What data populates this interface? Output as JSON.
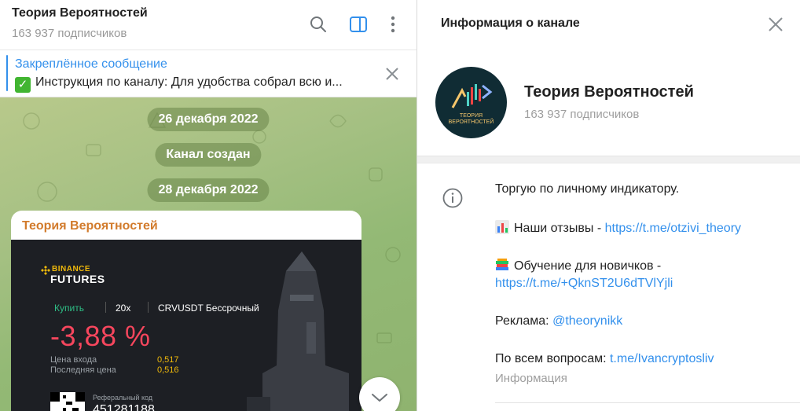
{
  "chat": {
    "title": "Теория Вероятностей",
    "subscribers": "163 937 подписчиков",
    "pinned_title": "Закреплённое сообщение",
    "pinned_text": "Инструкция по каналу:  Для удобства собрал всю и...",
    "dates": [
      "26 декабря 2022",
      "Канал создан",
      "28 декабря 2022"
    ],
    "message_author": "Теория Вероятностей"
  },
  "trade_card": {
    "brand": "BINANCE",
    "product": "FUTURES",
    "side": "Купить",
    "leverage": "20x",
    "pair": "CRVUSDT Бессрочный",
    "pnl": "-3,88 %",
    "entry_label": "Цена входа",
    "entry_value": "0,517",
    "last_label": "Последняя цена",
    "last_value": "0,516",
    "ref_label": "Реферальный код",
    "ref_code": "451281188"
  },
  "info": {
    "header": "Информация о канале",
    "name": "Теория Вероятностей",
    "subscribers": "163 937 подписчиков",
    "avatar_text_1": "ТЕОРИЯ",
    "avatar_text_2": "ВЕРОЯТНОСТЕЙ",
    "desc_1": "Торгую по личному индикатору.",
    "desc_2_prefix": "Наши отзывы - ",
    "desc_2_link": "https://t.me/otzivi_theory",
    "desc_3_prefix": "Обучение для новичков -",
    "desc_3_link": "https://t.me/+QknST2U6dTVlYjli",
    "desc_4_prefix": "Реклама: ",
    "desc_4_link": "@theorynikk",
    "desc_5_prefix": "По всем вопросам: ",
    "desc_5_link": "t.me/Ivancryptosliv",
    "caption": "Информация"
  },
  "colors": {
    "accent": "#3390ec",
    "author": "#d27b2c",
    "loss": "#f6465d",
    "buy": "#2ebd85",
    "binance": "#f0b90b"
  },
  "icons": [
    "search-icon",
    "sidebar-toggle-icon",
    "more-vertical-icon",
    "close-icon",
    "chevron-down-icon",
    "info-icon",
    "chart-emoji-icon",
    "books-emoji-icon",
    "check-emoji-icon"
  ]
}
